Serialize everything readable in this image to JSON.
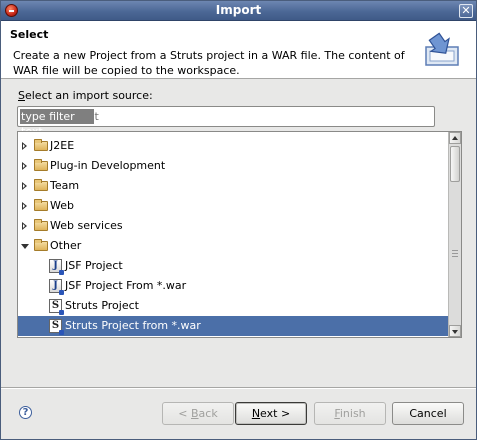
{
  "window": {
    "title": "Import",
    "close_glyph": "✕"
  },
  "banner": {
    "title": "Select",
    "description": "Create a new Project from a Struts project in a WAR file. The content of WAR file will be copied to the workspace.",
    "icon": "import-wizard-icon"
  },
  "source": {
    "label_prefix": "",
    "label_mnemonic": "S",
    "label_rest": "elect an import source:",
    "filter_placeholder": "type filter text",
    "filter_value": "type filter text"
  },
  "tree": {
    "items": [
      {
        "label": "J2EE",
        "type": "folder",
        "expanded": false
      },
      {
        "label": "Plug-in Development",
        "type": "folder",
        "expanded": false
      },
      {
        "label": "Team",
        "type": "folder",
        "expanded": false
      },
      {
        "label": "Web",
        "type": "folder",
        "expanded": false
      },
      {
        "label": "Web services",
        "type": "folder",
        "expanded": false
      },
      {
        "label": "Other",
        "type": "folder",
        "expanded": true
      },
      {
        "label": "JSF Project",
        "type": "leaf",
        "icon": "jsf-project-icon",
        "glyph": "J"
      },
      {
        "label": "JSF Project From *.war",
        "type": "leaf",
        "icon": "jsf-project-icon",
        "glyph": "J"
      },
      {
        "label": "Struts Project",
        "type": "leaf",
        "icon": "struts-project-icon",
        "glyph": "S"
      },
      {
        "label": "Struts Project from *.war",
        "type": "leaf",
        "icon": "struts-project-icon",
        "glyph": "S",
        "selected": true
      }
    ]
  },
  "buttons": {
    "help_glyph": "?",
    "back": {
      "prefix": "< ",
      "mnemonic": "B",
      "rest": "ack",
      "enabled": false
    },
    "next": {
      "prefix": "",
      "mnemonic": "N",
      "rest": "ext >",
      "enabled": true
    },
    "finish": {
      "prefix": "",
      "mnemonic": "F",
      "rest": "inish",
      "enabled": false
    },
    "cancel": {
      "label": "Cancel",
      "enabled": true
    }
  },
  "colors": {
    "titlebar": "#4c6896",
    "selection": "#4b6fa8"
  }
}
